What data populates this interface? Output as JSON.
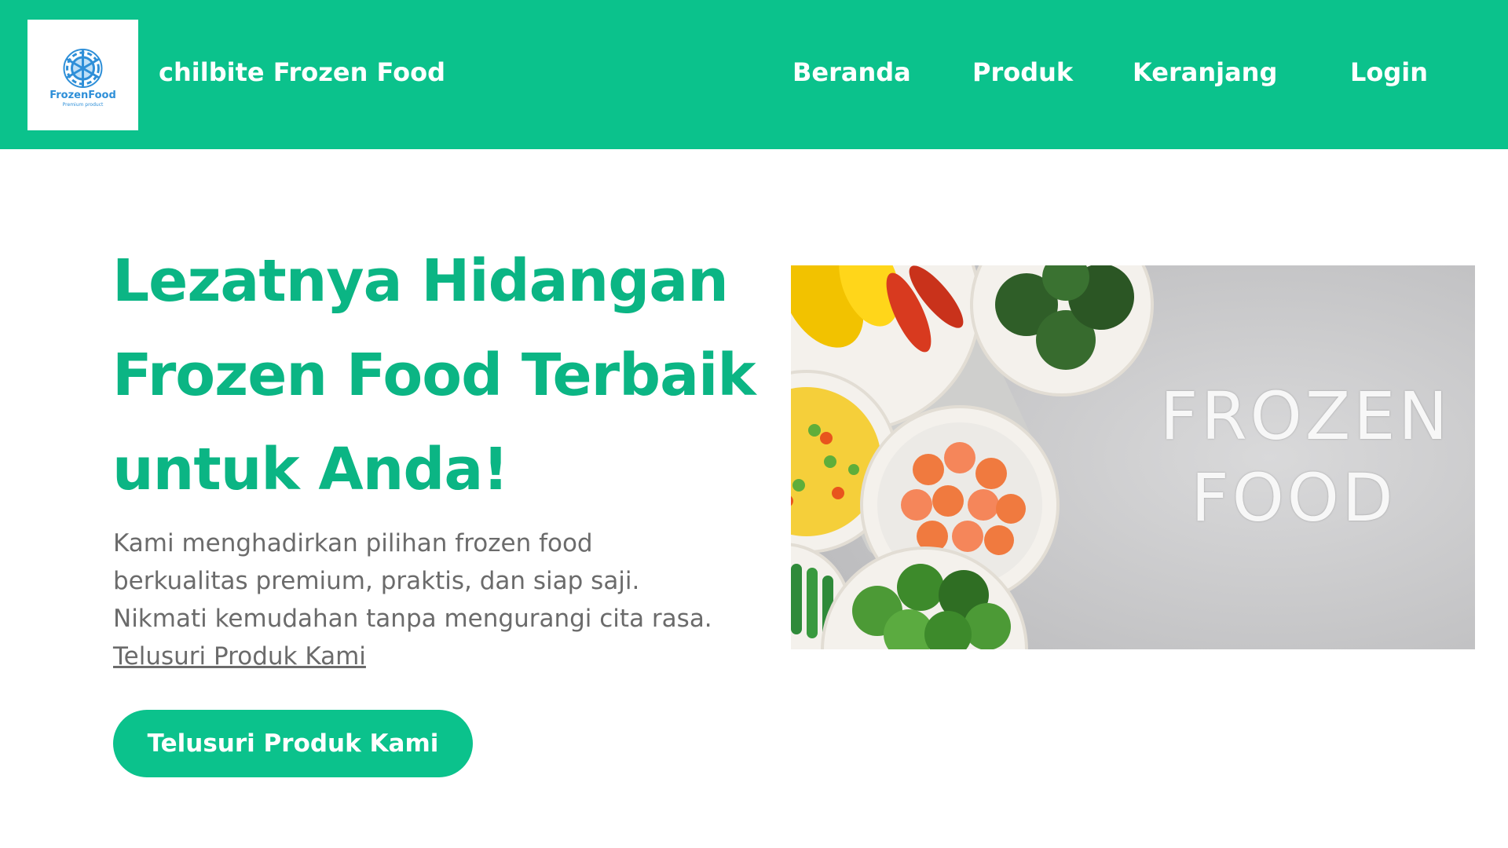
{
  "header": {
    "logo": {
      "icon": "snowflake-icon",
      "brand_text": "FrozenFood",
      "tagline": "Premium product"
    },
    "brand_name": "chilbite Frozen Food",
    "nav": {
      "beranda": "Beranda",
      "produk": "Produk",
      "keranjang": "Keranjang",
      "login": "Login"
    }
  },
  "hero": {
    "title_lines": [
      "Lezatnya Hidangan",
      "Frozen Food Terbaik",
      "untuk Anda!"
    ],
    "description_lines": [
      "Kami menghadirkan pilihan frozen food",
      "berkualitas premium, praktis, dan siap saji.",
      "Nikmati kemudahan tanpa mengurangi cita rasa."
    ],
    "link_text": "Telusuri Produk Kami",
    "button_label": "Telusuri Produk Kami",
    "image": {
      "text_lines": [
        "FROZEN",
        "FOOD"
      ]
    }
  },
  "colors": {
    "accent": "#0bc28c",
    "title": "#0bb584",
    "body_text": "#6b6b6b",
    "logo_blue": "#2e8fd8"
  }
}
